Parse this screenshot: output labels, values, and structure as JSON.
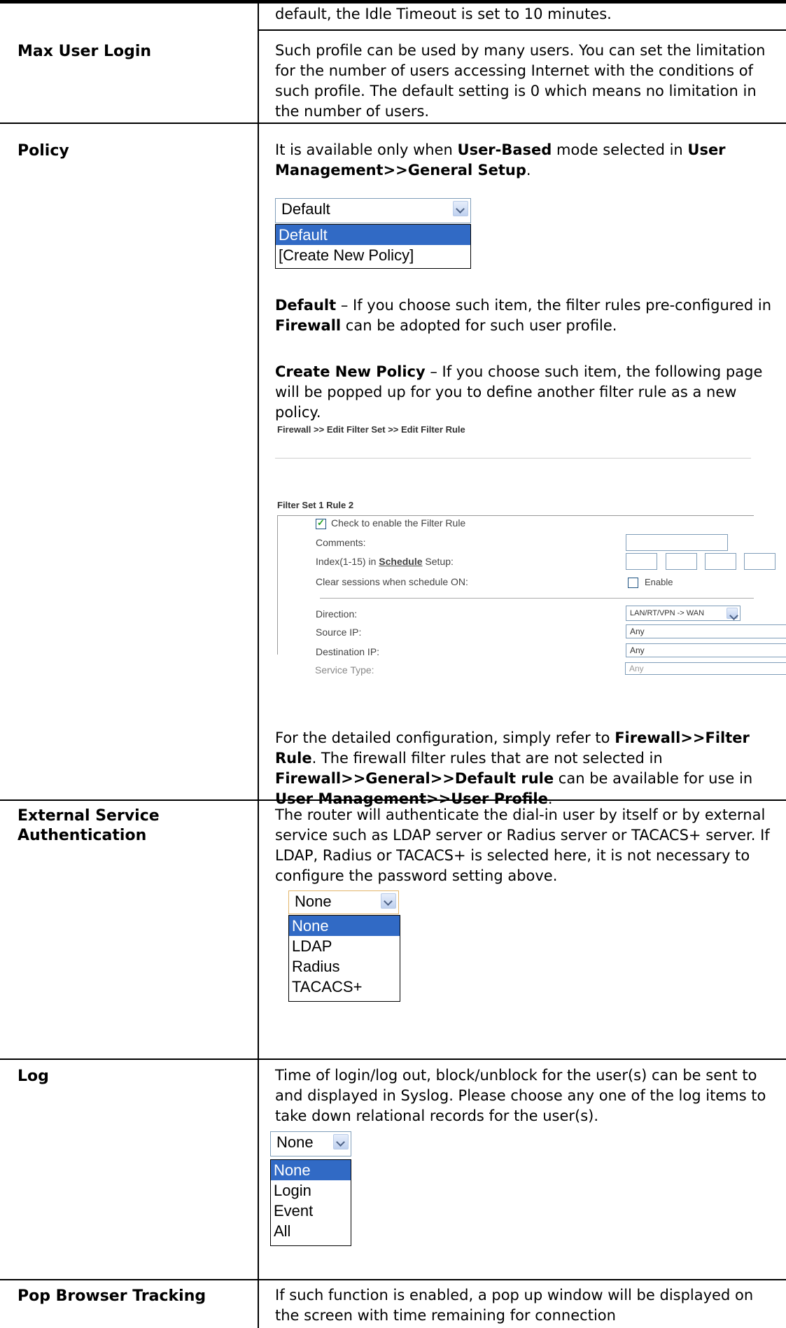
{
  "intro_text": "default, the Idle Timeout is set to 10 minutes.",
  "rows": {
    "max_user_login": {
      "label": "Max User Login",
      "text": "Such profile can be used by many users. You can set the limitation for the number of users accessing Internet with the conditions of such profile. The default setting is 0 which means no limitation in the number of users."
    },
    "policy": {
      "label": "Policy",
      "avail_pre": "It is available only when ",
      "avail_b1": "User-Based",
      "avail_mid": " mode selected in ",
      "avail_b2": "User Management>>General Setup",
      "avail_end": ".",
      "dropdown": {
        "selected": "Default",
        "options": [
          "Default",
          "[Create New Policy]"
        ]
      },
      "default_b": "Default",
      "default_text_1": " – If you choose such item, the filter rules pre-configured in ",
      "default_b2": "Firewall",
      "default_text_2": " can be adopted for such user profile.",
      "create_b": "Create New Policy",
      "create_text": " – If you choose such item, the following page will be popped up for you to define another filter rule as a new policy.",
      "firewall": {
        "breadcrumb": "Firewall >> Edit Filter Set >> Edit Filter Rule",
        "set_title": "Filter Set 1 Rule 2",
        "enable_label": "Check to enable the Filter Rule",
        "comments_label": "Comments:",
        "index_pre": "Index(1-15) in ",
        "index_link": "Schedule",
        "index_post": " Setup:",
        "clear_label": "Clear sessions when schedule ON:",
        "enable_text": "Enable",
        "direction_label": "Direction:",
        "direction_value": "LAN/RT/VPN -> WAN",
        "source_label": "Source IP:",
        "source_value": "Any",
        "dest_label": "Destination IP:",
        "dest_value": "Any",
        "service_label": "Service Type:",
        "service_value": "Any"
      },
      "after_1": "For the detailed configuration, simply refer to ",
      "after_b1": "Firewall>>Filter Rule",
      "after_2": ". The firewall filter rules that are not selected in ",
      "after_b2": "Firewall>>General>>Default rule",
      "after_3": " can be available for use in ",
      "after_b3": "User Management>>User Profile",
      "after_4": "."
    },
    "external": {
      "label": "External Service Authentication",
      "text": "The router will authenticate the dial-in user by itself or by external service such as LDAP server or Radius server or TACACS+ server. If LDAP, Radius or TACACS+ is selected here, it is not necessary to configure the password setting above.",
      "dropdown": {
        "selected": "None",
        "options": [
          "None",
          "LDAP",
          "Radius",
          "TACACS+"
        ]
      }
    },
    "log": {
      "label": "Log",
      "text": "Time of login/log out, block/unblock for the user(s) can be sent to and displayed in Syslog. Please choose any one of the log items to take down relational records for the user(s).",
      "dropdown": {
        "selected": "None",
        "options": [
          "None",
          "Login",
          "Event",
          "All"
        ]
      }
    },
    "pop": {
      "label": "Pop Browser Tracking",
      "text": "If such function is enabled, a pop up window will be displayed on the screen with time remaining for connection"
    }
  }
}
